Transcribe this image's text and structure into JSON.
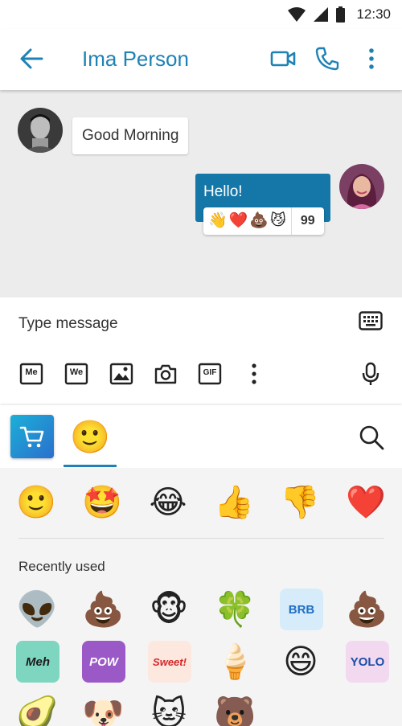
{
  "status": {
    "time": "12:30"
  },
  "header": {
    "title": "Ima Person"
  },
  "messages": [
    {
      "from": "contact",
      "text": "Good Morning"
    },
    {
      "from": "me",
      "text": "Hello!",
      "reactions": [
        "👋",
        "❤️",
        "💩",
        "😼"
      ],
      "reaction_count": "99"
    }
  ],
  "composer": {
    "placeholder": "Type message"
  },
  "toolbar": {
    "me_label": "Me",
    "we_label": "We",
    "gif_label": "GIF"
  },
  "emoji_panel": {
    "quick": [
      "🙂",
      "🤩",
      "😂",
      "👍",
      "👎",
      "❤️"
    ],
    "recent_label": "Recently used",
    "recent": [
      "👽",
      "💩",
      "🐵",
      "🍀",
      "BRB",
      "💩",
      "Meh",
      "POW",
      "Sweet!",
      "🍦",
      "😄",
      "YOLO",
      "🥑",
      "🐶",
      "🐱",
      "🐻"
    ]
  },
  "colors": {
    "accent": "#1f82b6",
    "bubble_out": "#1577a8",
    "chat_bg": "#ececec"
  }
}
